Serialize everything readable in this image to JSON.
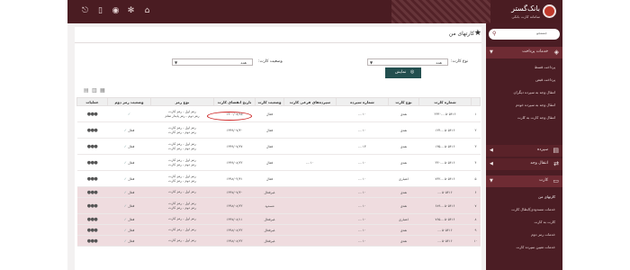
{
  "brand": {
    "name": "بانک‌گستر",
    "tagline": "سامانه کارت بانکی"
  },
  "sidebar": {
    "search_placeholder": "جستجو",
    "sections": [
      {
        "label": "خدمات پرداخت",
        "items": [
          "پرداخت قسط",
          "پرداخت قبض",
          "انتقال وجه به سپرده دیگران",
          "انتقال وجه به سپرده خودم",
          "انتقال وجه کارت به کارت"
        ]
      },
      {
        "label": "سپرده"
      },
      {
        "label": "انتقال وجه"
      },
      {
        "label": "کارت",
        "items": [
          "کارتهای من",
          "خدمات مسدودی/ابطال کارت",
          "کارت به کارت",
          "خدمات رمز دوم",
          "خدمات تعیین سپرده کارت"
        ]
      }
    ]
  },
  "page": {
    "title": "کارتهای من",
    "filters": {
      "card_type_label": "نوع کارت:",
      "card_type_value": "همه",
      "card_status_label": "وضعیت کارت:",
      "card_status_value": "همه"
    },
    "show_button": "نمایش"
  },
  "table": {
    "headers": [
      "",
      "شماره کارت",
      "نوع کارت",
      "شماره سپرده",
      "سپرده‌های فرعی کارت",
      "وضعیت کارت",
      "تاریخ انقضای کارت",
      "نوع رمز",
      "وضعیت رمز دوم",
      "عملیات"
    ],
    "rows": [
      {
        "idx": "۱",
        "card": "۵۰۵۴۱۶ ...۲۳۳۰",
        "type": "نقدی",
        "deposit": "۱۰ ...",
        "sub": "",
        "status": "فعال",
        "expiry": "۱۴۰۰/۰۸/۱۵",
        "pin_types": [
          "رمز اول - رمز کارت",
          "رمز دوم - رمز پایدار تمام"
        ],
        "pin2": "",
        "tint": "w"
      },
      {
        "idx": "۲",
        "card": "۵۰۵۴۱۶ ...۱۲۴",
        "type": "نقدی",
        "deposit": "۱۰ ...",
        "sub": "",
        "status": "فعال",
        "expiry": "۱۳۹۹/۰۷/۳۰",
        "pin_types": [
          "رمز اول - رمز کارت",
          "رمز دوم - رمز کارت"
        ],
        "pin2": "فعال",
        "tint": "w"
      },
      {
        "idx": "۳",
        "card": "۵۰۵۴۱۶ ...۱۳۵",
        "type": "نقدی",
        "deposit": "۱۳ ...",
        "sub": "",
        "status": "فعال",
        "expiry": "۱۳۹۹/۰۷/۲۷",
        "pin_types": [
          "رمز اول - رمز کارت",
          "رمز دوم - رمز کارت"
        ],
        "pin2": "فعال",
        "tint": "w"
      },
      {
        "idx": "۴",
        "card": "۵۰۵۴۱۶ ...۳۳۰",
        "type": "نقدی",
        "deposit": "۱۰ ...",
        "sub": "۱۰ ...",
        "status": "فعال",
        "expiry": "۱۳۹۹/۰۸/۲۲",
        "pin_types": [
          "رمز اول - رمز کارت",
          "رمز دوم - رمز کارت"
        ],
        "pin2": "فعال",
        "tint": "w"
      },
      {
        "idx": "۵",
        "card": "۵۰۵۴۱۶ ...۷۴۲",
        "type": "اعتباری",
        "deposit": "۱۰ ...",
        "sub": "",
        "status": "فعال",
        "expiry": "۱۳۹۸/۰۴/۳۱",
        "pin_types": [
          "رمز اول - رمز کارت",
          "رمز دوم - رمز کارت"
        ],
        "pin2": "فعال",
        "tint": "w"
      },
      {
        "idx": "۶",
        "card": "۵۰۵۴۱۶ ...",
        "type": "نقدی",
        "deposit": "۱۰ ...",
        "sub": "",
        "status": "غیرفعال",
        "expiry": "۱۳۹۷/۰۷/۳۰",
        "pin_types": [
          "رمز اول - رمز کارت"
        ],
        "pin2": "فعال",
        "tint": "p"
      },
      {
        "idx": "۷",
        "card": "۵۰۵۴۱۶ ...۶۸۹",
        "type": "نقدی",
        "deposit": "۱۰ ...",
        "sub": "",
        "status": "مسدود",
        "expiry": "۱۳۹۸/۰۸/۲۲",
        "pin_types": [
          "رمز اول - رمز کارت",
          "رمز دوم - رمز کارت"
        ],
        "pin2": "فعال",
        "tint": "p"
      },
      {
        "idx": "۸",
        "card": "۵۰۵۴۱۶ ...۷۶۵",
        "type": "اعتباری",
        "deposit": "۱۰ ...",
        "sub": "",
        "status": "غیرفعال",
        "expiry": "۱۳۹۷/۰۸/۱۱",
        "pin_types": [
          "رمز اول - رمز کارت"
        ],
        "pin2": "فعال",
        "tint": "p"
      },
      {
        "idx": "۹",
        "card": "۵۰۵۴۱۶ ...",
        "type": "نقدی",
        "deposit": "۱۰ ...",
        "sub": "",
        "status": "غیرفعال",
        "expiry": "۱۳۹۸/۰۸/۲۲",
        "pin_types": [
          "رمز اول - رمز کارت"
        ],
        "pin2": "فعال",
        "tint": "p"
      },
      {
        "idx": "۱۰",
        "card": "۵۰۵۴۱۶ ...",
        "type": "نقدی",
        "deposit": "۱۰ ...",
        "sub": "",
        "status": "غیرفعال",
        "expiry": "۱۳۹۸/۰۸/۲۲",
        "pin_types": [
          "رمز اول - رمز کارت"
        ],
        "pin2": "فعال",
        "tint": "p"
      }
    ]
  },
  "colors": {
    "topbar": "#4a1c22",
    "sidebar": "#4b1d24",
    "accent": "#234f4f",
    "highlight_row": "#efdcdf",
    "annotation": "#cc2222"
  }
}
